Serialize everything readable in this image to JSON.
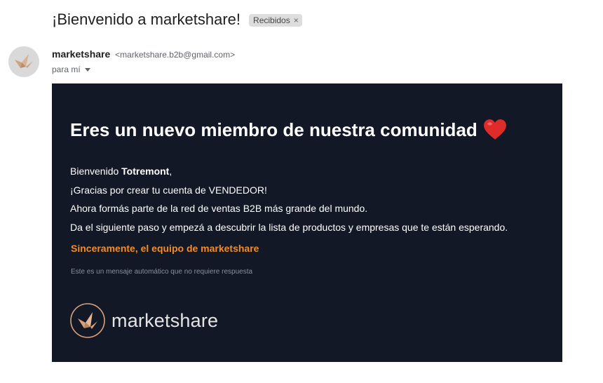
{
  "header": {
    "subject": "¡Bienvenido a marketshare!",
    "label_chip": "Recibidos",
    "chip_close": "×"
  },
  "sender": {
    "name": "marketshare",
    "email": "<marketshare.b2b@gmail.com>",
    "to": "para mí"
  },
  "email_body": {
    "headline": "Eres un nuevo miembro de nuestra comunidad",
    "greeting_prefix": "Bienvenido ",
    "greeting_name": "Totremont",
    "greeting_suffix": ",",
    "line2": "¡Gracias por crear tu cuenta de VENDEDOR!",
    "line3": "Ahora formás parte de la red de ventas B2B más grande del mundo.",
    "line4": "Da el siguiente paso y empezá a descubrir la lista de productos y empresas que te están esperando.",
    "signoff": "Sinceramente, el equipo de marketshare",
    "auto_note": "Este es un mensaje automático que no requiere respuesta",
    "logo_word": "marketshare"
  },
  "icons": {
    "avatar": "origami-crane-icon",
    "heart": "heart-icon",
    "logo": "origami-crane-logo-icon",
    "caret": "chevron-down-icon"
  },
  "colors": {
    "card_bg": "#121826",
    "accent_orange": "#f28c28",
    "heart_red": "#e02b2b",
    "logo_tan": "#d9a27a"
  }
}
